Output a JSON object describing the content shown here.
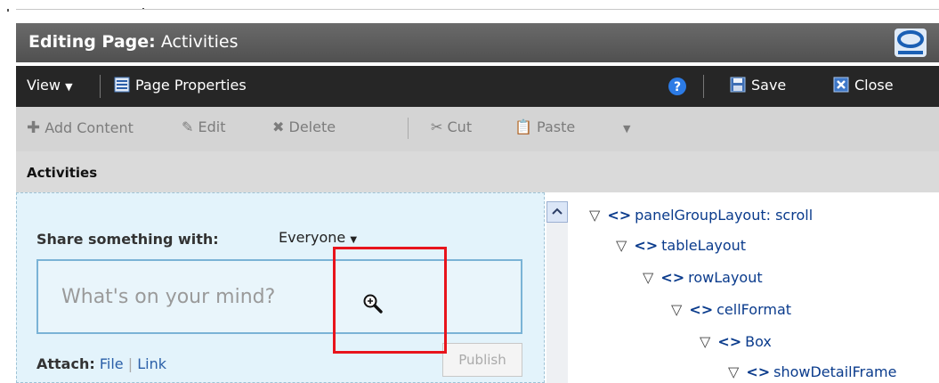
{
  "window": {
    "title_prefix": "Editing Page:",
    "title_page": "Activities"
  },
  "menubar": {
    "view_label": "View",
    "page_properties_label": "Page Properties",
    "save_label": "Save",
    "close_label": "Close"
  },
  "toolbar": {
    "add_content_label": "Add Content",
    "edit_label": "Edit",
    "delete_label": "Delete",
    "cut_label": "Cut",
    "paste_label": "Paste"
  },
  "breadcrumb": {
    "current": "Activities"
  },
  "share": {
    "label": "Share something with:",
    "audience": "Everyone",
    "placeholder": "What's on your mind?",
    "attach_label": "Attach:",
    "attach_file": "File",
    "attach_link": "Link",
    "publish_label": "Publish"
  },
  "tree": {
    "nodes": [
      {
        "label": "panelGroupLayout: scroll"
      },
      {
        "label": "tableLayout"
      },
      {
        "label": "rowLayout"
      },
      {
        "label": "cellFormat"
      },
      {
        "label": "Box"
      },
      {
        "label": "showDetailFrame"
      }
    ]
  },
  "colors": {
    "title_bg": "#5c5c5c",
    "menubar_bg": "#262626",
    "toolbar_bg": "#d4d4d4",
    "share_bg": "#e3f3fb",
    "highlight_red": "#e8141c",
    "tree_text": "#0a3b8c"
  }
}
